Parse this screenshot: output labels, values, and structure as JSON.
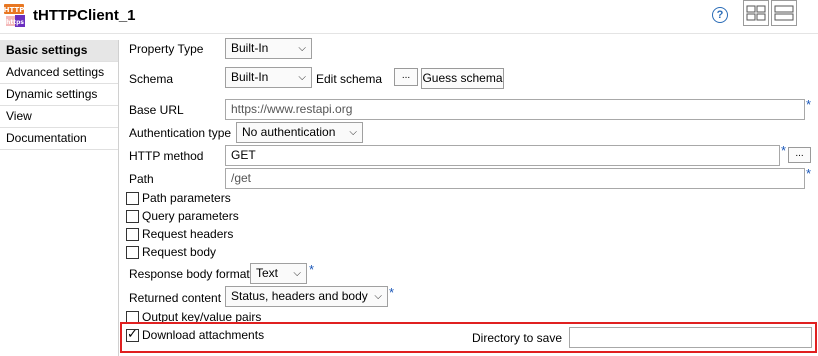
{
  "component": {
    "icon": "http-component-icon",
    "icon_text_top": "HTTP",
    "icon_text_bottom": "https",
    "title": "tHTTPClient_1",
    "help": "?"
  },
  "sidebar": {
    "items": [
      {
        "label": "Basic settings",
        "active": true
      },
      {
        "label": "Advanced settings"
      },
      {
        "label": "Dynamic settings"
      },
      {
        "label": "View"
      },
      {
        "label": "Documentation"
      }
    ]
  },
  "form": {
    "property_type": {
      "label": "Property Type",
      "value": "Built-In"
    },
    "schema": {
      "label": "Schema",
      "value": "Built-In",
      "edit_label": "Edit schema",
      "ellipsis": "...",
      "guess_label": "Guess schema"
    },
    "base_url": {
      "label": "Base URL",
      "value": "https://www.restapi.org",
      "required": "*"
    },
    "auth_type": {
      "label": "Authentication type",
      "value": "No authentication"
    },
    "http_method": {
      "label": "HTTP method",
      "value": "GET",
      "required": "*",
      "ellipsis": "..."
    },
    "path": {
      "label": "Path",
      "value": "/get",
      "required": "*"
    },
    "path_parameters": {
      "label": "Path parameters",
      "checked": false
    },
    "query_parameters": {
      "label": "Query parameters",
      "checked": false
    },
    "request_headers": {
      "label": "Request headers",
      "checked": false
    },
    "request_body": {
      "label": "Request body",
      "checked": false
    },
    "response_body_format": {
      "label": "Response body format",
      "value": "Text",
      "required": "*"
    },
    "returned_content": {
      "label": "Returned content",
      "value": "Status, headers and body",
      "required": "*"
    },
    "output_kv": {
      "label": "Output key/value pairs",
      "checked": false
    },
    "download_attachments": {
      "label": "Download attachments",
      "checked": true
    },
    "directory_to_save": {
      "label": "Directory to save",
      "value": ""
    }
  },
  "colors": {
    "highlight": "#e02020",
    "required_star": "#1a56b8",
    "help": "#2a6cb7"
  }
}
